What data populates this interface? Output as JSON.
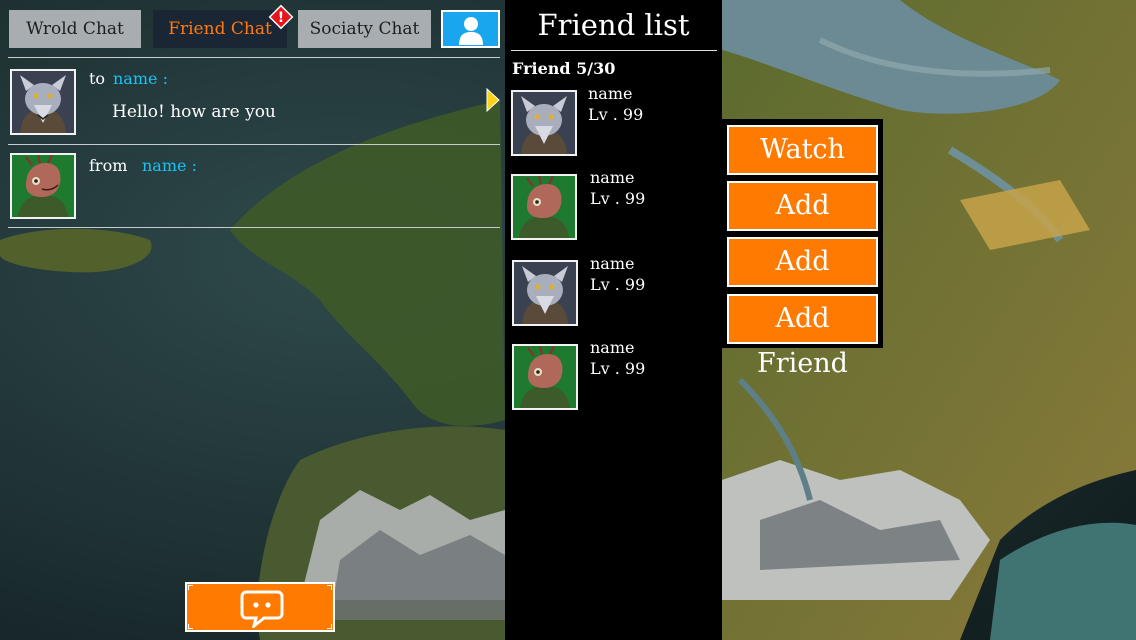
{
  "chat": {
    "tabs": [
      {
        "label": "Wrold Chat"
      },
      {
        "label": "Friend Chat"
      },
      {
        "label": "Sociaty Chat"
      }
    ],
    "badge": "!",
    "messages": [
      {
        "direction": "to",
        "name": "name :",
        "text": "Hello! how are you",
        "avatar": "wolf-warrior"
      },
      {
        "direction": "from",
        "name": "name :",
        "text": "",
        "avatar": "lizard-warrior"
      }
    ]
  },
  "friend_list": {
    "title": "Friend list",
    "count_label": "Friend 5/30",
    "friends": [
      {
        "name": "name",
        "level": "Lv . 99",
        "avatar": "wolf-warrior"
      },
      {
        "name": "name",
        "level": "Lv . 99",
        "avatar": "lizard-warrior"
      },
      {
        "name": "name",
        "level": "Lv . 99",
        "avatar": "wolf-warrior"
      },
      {
        "name": "name",
        "level": "Lv . 99",
        "avatar": "lizard-warrior"
      }
    ]
  },
  "actions": [
    {
      "label": "Watch"
    },
    {
      "label": "Add Friend"
    },
    {
      "label": "Add Friend"
    },
    {
      "label": "Add Friend"
    }
  ],
  "colors": {
    "accent": "#ff7a00",
    "name_text": "#19c2f2",
    "active_tab_bg": "#1a2634",
    "inactive_tab_bg": "#a7adb0",
    "profile_btn": "#19a6ee"
  }
}
